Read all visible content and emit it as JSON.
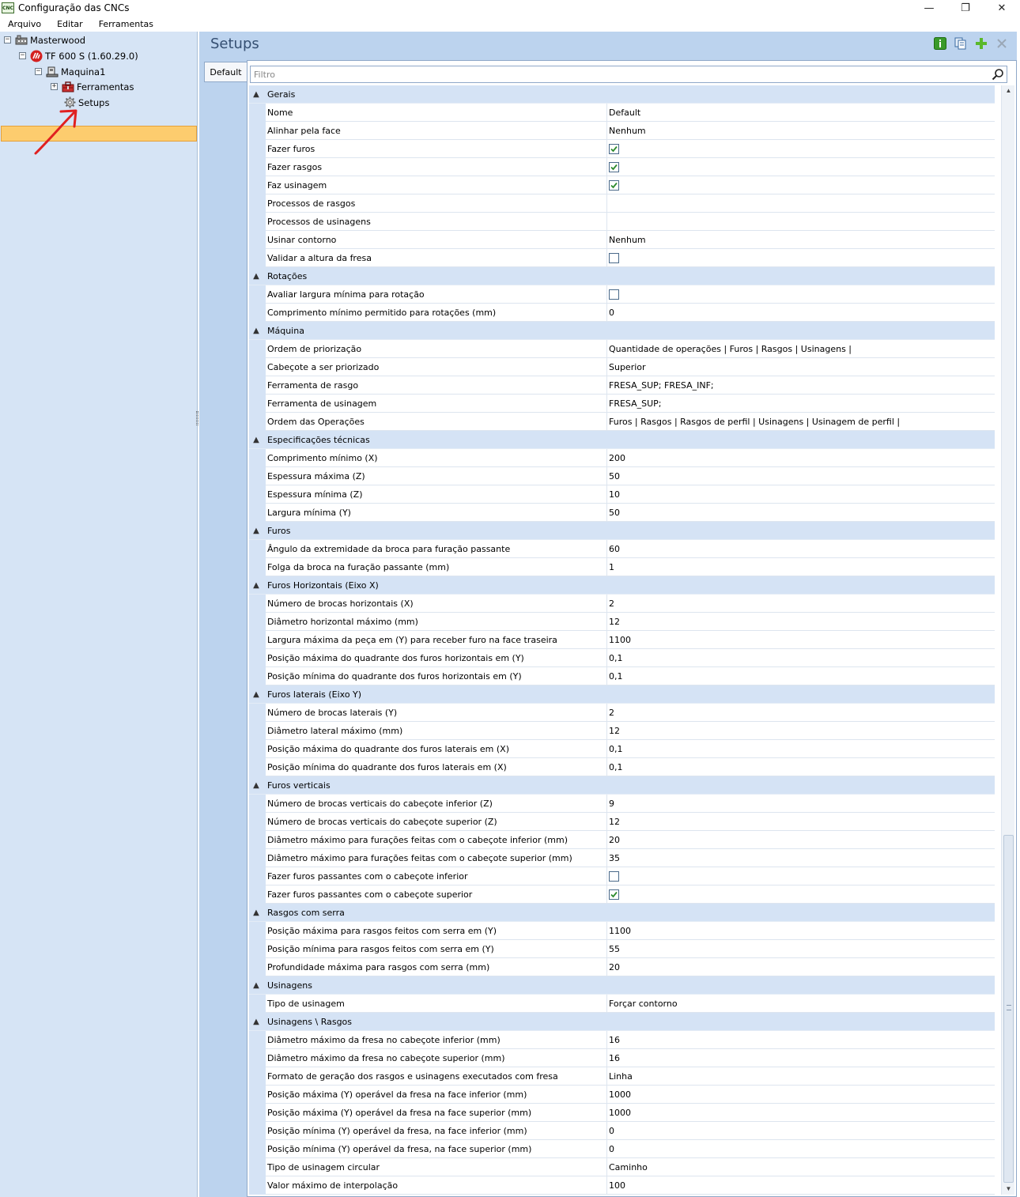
{
  "window": {
    "title": "Configuração das CNCs",
    "icon_text": "CNC",
    "controls": [
      "—",
      "❐",
      "✕"
    ]
  },
  "menu": [
    "Arquivo",
    "Editar",
    "Ferramentas"
  ],
  "tree": {
    "nodes": [
      {
        "label": "Masterwood",
        "expander": "⊟",
        "icon": "company-icon"
      },
      {
        "label": "TF 600 S (1.60.29.0)",
        "expander": "⊟",
        "icon": "cnc-brand-icon"
      },
      {
        "label": "Maquina1",
        "expander": "⊟",
        "icon": "machine-icon"
      },
      {
        "label": "Ferramentas",
        "expander": "⊞",
        "icon": "toolbox-icon"
      },
      {
        "label": "Setups",
        "expander": "",
        "icon": "gear-icon",
        "selected": true
      }
    ]
  },
  "content": {
    "title": "Setups",
    "tab": "Default",
    "filter_placeholder": "Filtro",
    "toolbar": [
      "info-icon",
      "copy-icon",
      "add-icon",
      "delete-icon"
    ]
  },
  "grid": {
    "categories": [
      {
        "name": "Gerais",
        "rows": [
          {
            "name": "Nome",
            "value": "Default"
          },
          {
            "name": "Alinhar pela face",
            "value": "Nenhum"
          },
          {
            "name": "Fazer furos",
            "check": true
          },
          {
            "name": "Fazer rasgos",
            "check": true
          },
          {
            "name": "Faz usinagem",
            "check": true
          },
          {
            "name": "Processos de rasgos",
            "value": ""
          },
          {
            "name": "Processos de usinagens",
            "value": ""
          },
          {
            "name": "Usinar contorno",
            "value": "Nenhum"
          },
          {
            "name": "Validar a altura da fresa",
            "check": false
          }
        ]
      },
      {
        "name": "Rotações",
        "rows": [
          {
            "name": "Avaliar largura mínima para rotação",
            "check": false
          },
          {
            "name": "Comprimento mínimo permitido para rotações (mm)",
            "value": "0"
          }
        ]
      },
      {
        "name": "Máquina",
        "rows": [
          {
            "name": "Ordem de priorização",
            "value": "Quantidade de operações | Furos | Rasgos | Usinagens |"
          },
          {
            "name": "Cabeçote a ser priorizado",
            "value": "Superior"
          },
          {
            "name": "Ferramenta de rasgo",
            "value": "FRESA_SUP; FRESA_INF;"
          },
          {
            "name": "Ferramenta de usinagem",
            "value": "FRESA_SUP;"
          },
          {
            "name": "Ordem das Operações",
            "value": "Furos | Rasgos | Rasgos de perfil | Usinagens | Usinagem de perfil |"
          }
        ]
      },
      {
        "name": "Especificações técnicas",
        "rows": [
          {
            "name": "Comprimento mínimo (X)",
            "value": "200"
          },
          {
            "name": "Espessura máxima (Z)",
            "value": "50"
          },
          {
            "name": "Espessura mínima (Z)",
            "value": "10"
          },
          {
            "name": "Largura mínima (Y)",
            "value": "50"
          }
        ]
      },
      {
        "name": "Furos",
        "rows": [
          {
            "name": "Ângulo da extremidade da broca para furação passante",
            "value": "60"
          },
          {
            "name": "Folga da broca na furação passante (mm)",
            "value": "1"
          }
        ]
      },
      {
        "name": "Furos Horizontais (Eixo X)",
        "rows": [
          {
            "name": "Número de brocas horizontais (X)",
            "value": "2"
          },
          {
            "name": "Diâmetro horizontal máximo (mm)",
            "value": "12"
          },
          {
            "name": "Largura máxima da peça em (Y) para receber furo na face traseira",
            "value": "1100"
          },
          {
            "name": "Posição máxima do quadrante dos furos horizontais em (Y)",
            "value": "0,1"
          },
          {
            "name": "Posição mínima do quadrante dos furos horizontais em (Y)",
            "value": "0,1"
          }
        ]
      },
      {
        "name": "Furos laterais (Eixo Y)",
        "rows": [
          {
            "name": "Número de brocas laterais (Y)",
            "value": "2"
          },
          {
            "name": "Diâmetro lateral máximo (mm)",
            "value": "12"
          },
          {
            "name": "Posição máxima do quadrante dos furos laterais em (X)",
            "value": "0,1"
          },
          {
            "name": "Posição mínima do quadrante dos furos laterais em (X)",
            "value": "0,1"
          }
        ]
      },
      {
        "name": "Furos verticais",
        "rows": [
          {
            "name": "Número de brocas verticais do cabeçote inferior (Z)",
            "value": "9"
          },
          {
            "name": "Número de brocas verticais do cabeçote superior (Z)",
            "value": "12"
          },
          {
            "name": "Diâmetro máximo para furações feitas com o cabeçote inferior (mm)",
            "value": "20"
          },
          {
            "name": "Diâmetro máximo para furações feitas com o cabeçote superior (mm)",
            "value": "35"
          },
          {
            "name": "Fazer furos passantes com o cabeçote inferior",
            "check": false
          },
          {
            "name": "Fazer furos passantes com o cabeçote superior",
            "check": true
          }
        ]
      },
      {
        "name": "Rasgos com serra",
        "rows": [
          {
            "name": "Posição máxima para rasgos feitos com serra em (Y)",
            "value": "1100"
          },
          {
            "name": "Posição mínima para rasgos feitos com serra em (Y)",
            "value": "55"
          },
          {
            "name": "Profundidade máxima para rasgos com serra (mm)",
            "value": "20"
          }
        ]
      },
      {
        "name": "Usinagens",
        "rows": [
          {
            "name": "Tipo de usinagem",
            "value": "Forçar contorno"
          }
        ]
      },
      {
        "name": "Usinagens \\ Rasgos",
        "rows": [
          {
            "name": "Diâmetro máximo da fresa no cabeçote inferior (mm)",
            "value": "16"
          },
          {
            "name": "Diâmetro máximo da fresa no cabeçote superior (mm)",
            "value": "16"
          },
          {
            "name": "Formato de geração dos rasgos e usinagens executados com fresa",
            "value": "Linha"
          },
          {
            "name": "Posição máxima (Y) operável da fresa na face inferior (mm)",
            "value": "1000"
          },
          {
            "name": "Posição máxima (Y) operável da fresa na face superior (mm)",
            "value": "1000"
          },
          {
            "name": "Posição mínima (Y) operável da fresa, na face inferior (mm)",
            "value": "0"
          },
          {
            "name": "Posição mínima (Y) operável da fresa, na face superior (mm)",
            "value": "0"
          },
          {
            "name": "Tipo de usinagem circular",
            "value": "Caminho"
          },
          {
            "name": "Valor máximo de interpolação",
            "value": "100"
          }
        ]
      }
    ]
  },
  "colors": {
    "accent_blue": "#bcd3ee",
    "selection": "#fdcc6e",
    "check_green": "#2e8b2e",
    "annotation_arrow": "#e02020"
  }
}
